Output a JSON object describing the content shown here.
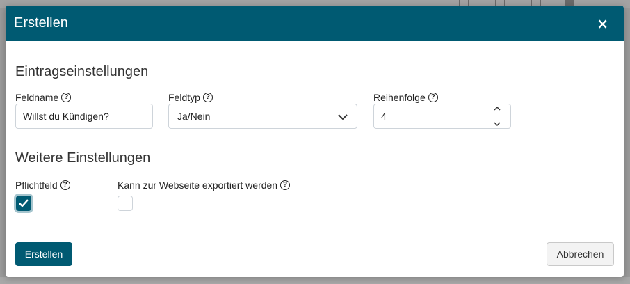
{
  "modal": {
    "title": "Erstellen",
    "close_label": "×",
    "entry_settings": {
      "heading": "Eintragseinstellungen",
      "fieldname": {
        "label": "Feldname",
        "value": "Willst du Kündigen?"
      },
      "fieldtype": {
        "label": "Feldtyp",
        "value": "Ja/Nein"
      },
      "order": {
        "label": "Reihenfolge",
        "value": "4"
      }
    },
    "more_settings": {
      "heading": "Weitere Einstellungen",
      "required": {
        "label": "Pflichtfeld",
        "checked": true
      },
      "export": {
        "label": "Kann zur Webseite exportiert werden",
        "checked": false
      }
    },
    "buttons": {
      "create": "Erstellen",
      "cancel": "Abbrechen"
    }
  },
  "help_icon_glyph": "?",
  "colors": {
    "primary": "#005a72",
    "overlay": "#9a9a9a"
  }
}
